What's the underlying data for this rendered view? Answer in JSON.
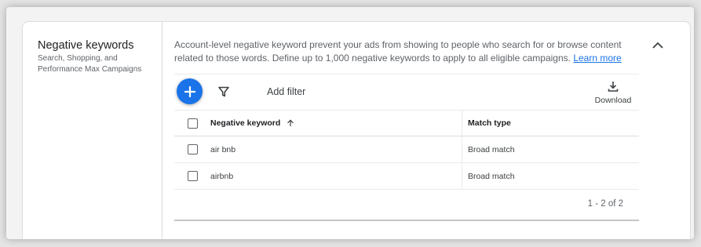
{
  "section": {
    "title": "Negative keywords",
    "subtitle": "Search, Shopping, and Performance Max Campaigns",
    "description": "Account-level negative keyword prevent your ads from showing to people who search for or browse content related to those words. Define up to 1,000 negative keywords to apply to all eligible campaigns.",
    "learn_more": "Learn more",
    "collapse_icon": "chevron-up-icon"
  },
  "toolbar": {
    "add_icon": "plus-icon",
    "filter_icon": "filter-icon",
    "add_filter": "Add filter",
    "download_label": "Download",
    "download_icon": "download-icon"
  },
  "table": {
    "headers": {
      "keyword": "Negative keyword",
      "match_type": "Match type"
    },
    "sort_icon": "arrow-up-icon",
    "rows": [
      {
        "keyword": "air bnb",
        "match_type": "Broad match"
      },
      {
        "keyword": "airbnb",
        "match_type": "Broad match"
      }
    ]
  },
  "pagination": {
    "text": "1 - 2 of 2"
  },
  "colors": {
    "accent": "#1a73e8",
    "text": "#3c4043",
    "muted": "#5f6368"
  }
}
